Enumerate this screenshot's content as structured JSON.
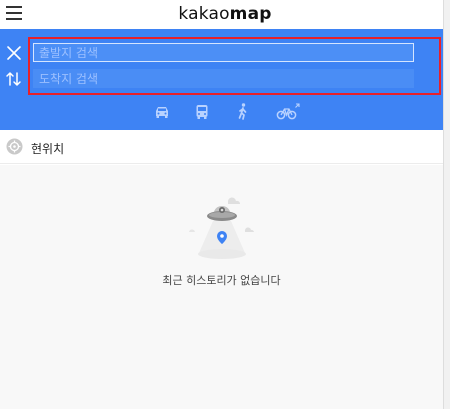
{
  "header": {
    "logo_part1": "kakao",
    "logo_part2": "map",
    "menu_icon": "hamburger-menu-icon"
  },
  "search": {
    "start_placeholder": "출발지 검색",
    "end_placeholder": "도착지 검색",
    "close_icon": "close-icon",
    "swap_icon": "swap-icon"
  },
  "transport_modes": [
    {
      "name": "car",
      "icon": "car-icon"
    },
    {
      "name": "bus",
      "icon": "bus-icon"
    },
    {
      "name": "walk",
      "icon": "walk-icon"
    },
    {
      "name": "bike",
      "icon": "bike-icon"
    }
  ],
  "current_location": {
    "label": "현위치",
    "icon": "current-location-icon"
  },
  "history": {
    "empty_message": "최근 히스토리가 없습니다"
  },
  "colors": {
    "panel_blue": "#3e83f4",
    "highlight_red": "#e8202a"
  }
}
